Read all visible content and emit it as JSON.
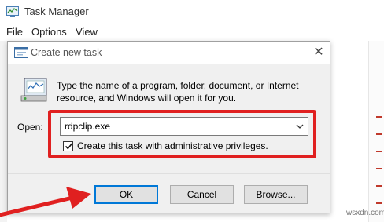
{
  "task_manager": {
    "title": "Task Manager",
    "menu": [
      "File",
      "Options",
      "View"
    ]
  },
  "dialog": {
    "title": "Create new task",
    "description": "Type the name of a program, folder, document, or Internet resource, and Windows will open it for you.",
    "open_label": "Open:",
    "input_value": "rdpclip.exe",
    "checkbox_label": "Create this task with administrative privileges.",
    "checkbox_checked": true,
    "buttons": {
      "ok": "OK",
      "cancel": "Cancel",
      "browse": "Browse..."
    },
    "close_glyph": "✕"
  },
  "watermark": "wsxdn.com",
  "colors": {
    "highlight": "#e02020",
    "default_button_border": "#0078d7",
    "dialog_bg": "#f0f0f0"
  },
  "icons": [
    "task-manager-icon",
    "run-title-icon",
    "run-app-icon",
    "dropdown-arrow-icon",
    "checkmark-icon",
    "red-arrow-annotation"
  ]
}
